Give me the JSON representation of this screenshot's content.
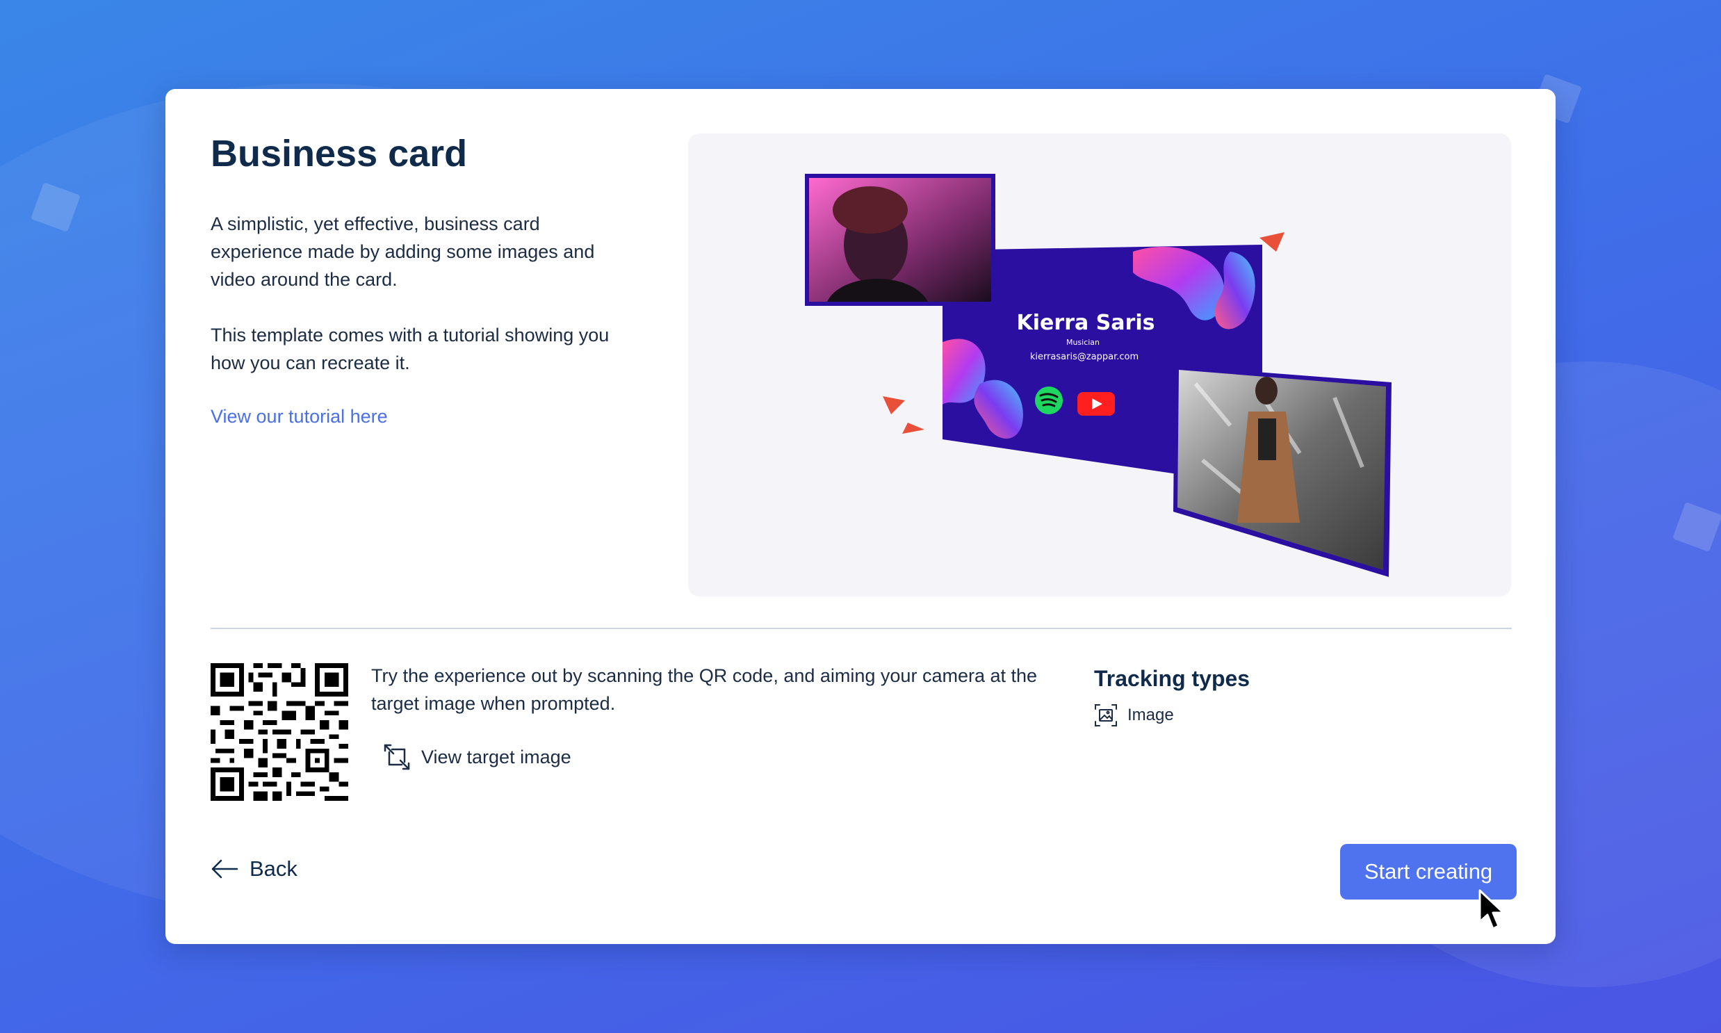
{
  "template": {
    "title": "Business card",
    "description_1": "A simplistic, yet effective, business card experience made by adding some images and video around the card.",
    "description_2": "This template comes with a tutorial showing you how you can recreate it.",
    "tutorial_link": "View our tutorial here"
  },
  "preview": {
    "card_name": "Kierra Saris",
    "card_role": "Musician",
    "card_email": "kierrasaris@zappar.com",
    "card_bg_color": "#2a0fa0",
    "accent_color": "#e8503a",
    "icons": [
      "spotify-icon",
      "youtube-icon"
    ]
  },
  "try_it": {
    "instructions": "Try the experience out by scanning the QR code, and aiming your camera at the target image when prompted.",
    "view_target_label": "View target image",
    "view_target_icon": "expand-icon"
  },
  "tracking": {
    "title": "Tracking types",
    "items": [
      {
        "label": "Image",
        "icon": "image-tracking-icon"
      }
    ]
  },
  "footer": {
    "back_label": "Back",
    "start_label": "Start creating"
  },
  "colors": {
    "primary_button": "#4f73ee",
    "link": "#4a6fe6",
    "heading": "#0f2a4a"
  }
}
